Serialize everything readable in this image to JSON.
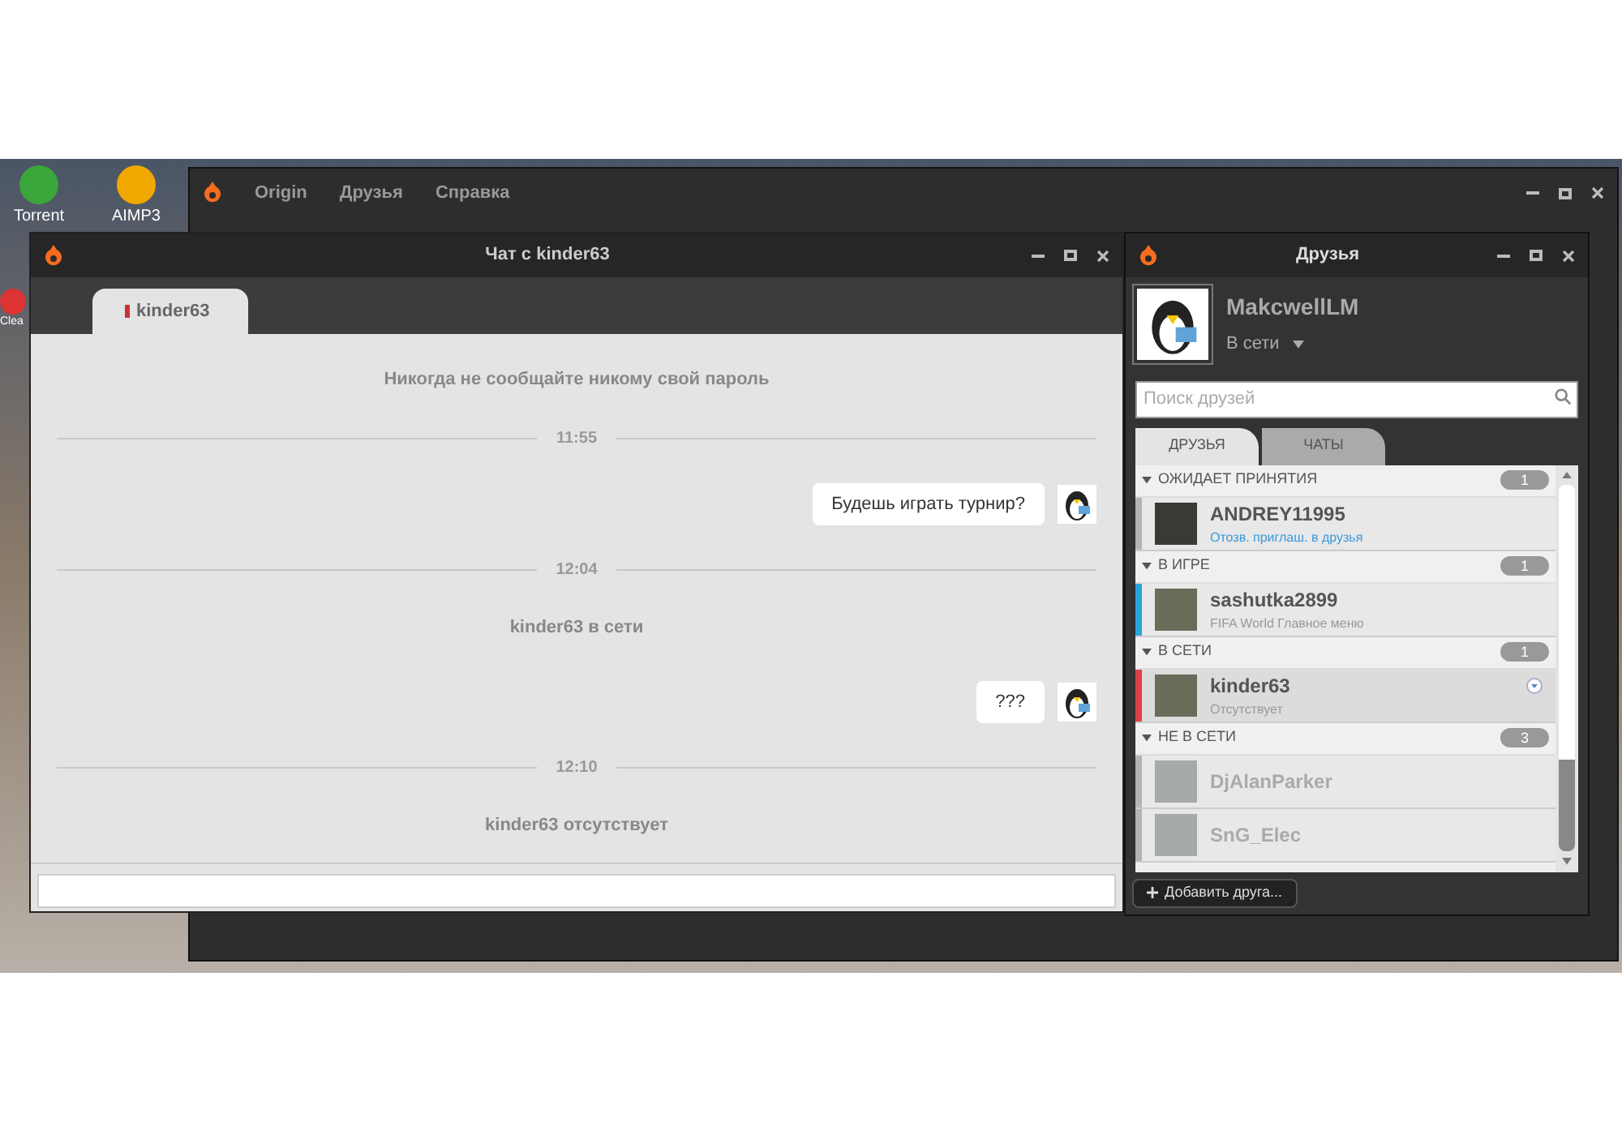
{
  "desktop": {
    "icons": [
      {
        "label": "Torrent"
      },
      {
        "label": "AIMP3"
      },
      {
        "label": "Clea"
      }
    ]
  },
  "main_window": {
    "menu": [
      "Origin",
      "Друзья",
      "Справка"
    ]
  },
  "chat_window": {
    "title": "Чат с kinder63",
    "tabs": [
      {
        "label": "kinder63",
        "selected": true
      }
    ],
    "messages": [
      {
        "kind": "notice",
        "text": "Никогда не сообщайте никому свой пароль"
      },
      {
        "kind": "time",
        "text": "11:55"
      },
      {
        "kind": "outgoing",
        "text": "Будешь играть турнир?"
      },
      {
        "kind": "time",
        "text": "12:04"
      },
      {
        "kind": "notice",
        "text": "kinder63 в сети"
      },
      {
        "kind": "outgoing",
        "text": "???"
      },
      {
        "kind": "time",
        "text": "12:10"
      },
      {
        "kind": "notice",
        "text": "kinder63 отсутствует"
      }
    ]
  },
  "friends_window": {
    "title": "Друзья",
    "profile": {
      "name": "MakcwellLM",
      "status": "В сети"
    },
    "search": {
      "placeholder": "Поиск друзей"
    },
    "tabs": [
      {
        "label": "ДРУЗЬЯ",
        "selected": true
      },
      {
        "label": "ЧАТЫ",
        "selected": false
      }
    ],
    "groups": [
      {
        "title": "ОЖИДАЕТ ПРИНЯТИЯ",
        "count": "1",
        "expanded": true,
        "friends": [
          {
            "name": "ANDREY11995",
            "subtitle": "Отозв. приглаш. в друзья",
            "kind": "invite",
            "color": "#b4b4b4",
            "online": true,
            "selected": false
          }
        ]
      },
      {
        "title": "В ИГРЕ",
        "count": "1",
        "expanded": true,
        "friends": [
          {
            "name": "sashutka2899",
            "subtitle": "FIFA World Главное меню",
            "kind": "friend",
            "color": "#2aa3d9",
            "online": true,
            "selected": false
          }
        ]
      },
      {
        "title": "В СЕТИ",
        "count": "1",
        "expanded": true,
        "friends": [
          {
            "name": "kinder63",
            "subtitle": "Отсутствует",
            "kind": "friend",
            "color": "#d9414a",
            "online": true,
            "selected": true
          }
        ]
      },
      {
        "title": "НЕ В СЕТИ",
        "count": "3",
        "expanded": true,
        "friends": [
          {
            "name": "DjAlanParker",
            "kind": "friend",
            "color": "#b4b4b4",
            "online": false,
            "selected": false
          },
          {
            "name": "SnG_Elec",
            "kind": "friend",
            "color": "#b4b4b4",
            "online": false,
            "selected": false
          }
        ]
      }
    ],
    "add_button": "Добавить друга..."
  }
}
